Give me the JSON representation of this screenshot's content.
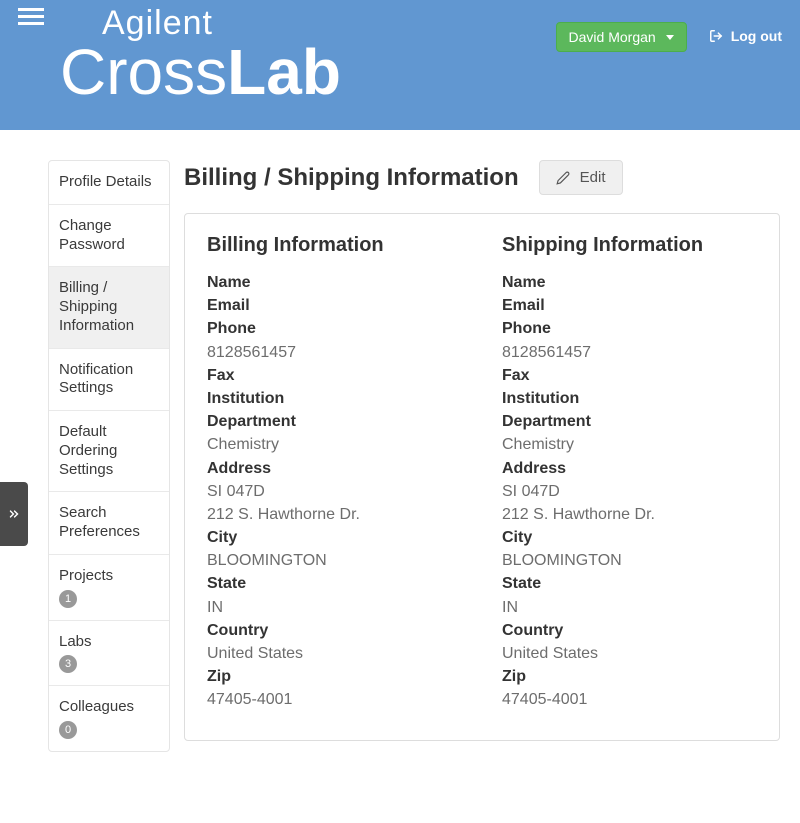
{
  "header": {
    "logo_top": "Agilent",
    "logo_left": "Cross",
    "logo_right": "Lab",
    "user_name": "David Morgan",
    "logout_label": "Log out"
  },
  "sidebar": {
    "items": [
      {
        "label": "Profile Details"
      },
      {
        "label": "Change Password"
      },
      {
        "label": "Billing / Shipping Information",
        "active": true
      },
      {
        "label": "Notification Settings"
      },
      {
        "label": "Default Ordering Settings"
      },
      {
        "label": "Search Preferences"
      },
      {
        "label": "Projects",
        "badge": "1"
      },
      {
        "label": "Labs",
        "badge": "3"
      },
      {
        "label": "Colleagues",
        "badge": "0"
      }
    ]
  },
  "main": {
    "title": "Billing / Shipping Information",
    "edit_label": "Edit",
    "billing_heading": "Billing Information",
    "shipping_heading": "Shipping Information",
    "labels": {
      "name": "Name",
      "email": "Email",
      "phone": "Phone",
      "fax": "Fax",
      "institution": "Institution",
      "department": "Department",
      "address": "Address",
      "city": "City",
      "state": "State",
      "country": "Country",
      "zip": "Zip"
    },
    "billing": {
      "phone": "8128561457",
      "department": "Chemistry",
      "address1": "SI 047D",
      "address2": "212 S. Hawthorne Dr.",
      "city": "BLOOMINGTON",
      "state": "IN",
      "country": "United States",
      "zip": "47405-4001"
    },
    "shipping": {
      "phone": "8128561457",
      "department": "Chemistry",
      "address1": "SI 047D",
      "address2": "212 S. Hawthorne Dr.",
      "city": "BLOOMINGTON",
      "state": "IN",
      "country": "United States",
      "zip": "47405-4001"
    }
  }
}
